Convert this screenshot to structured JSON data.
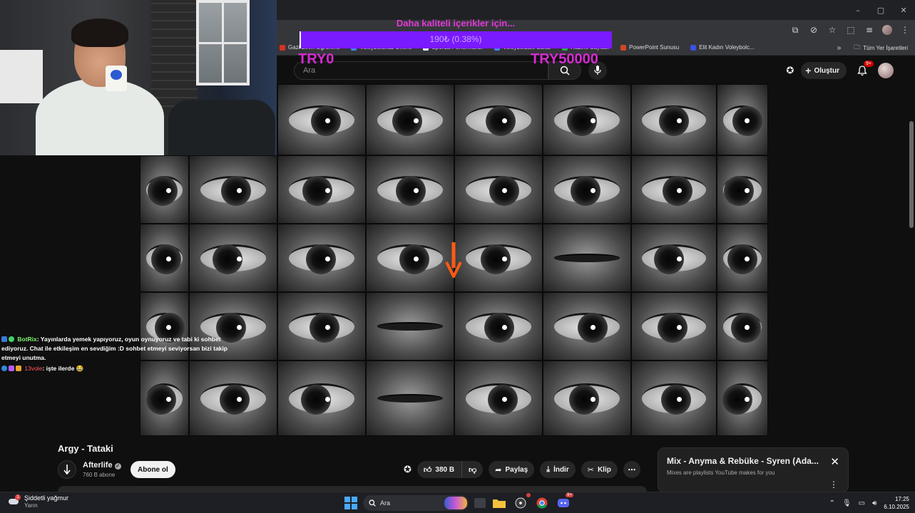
{
  "browser": {
    "window_controls": [
      "–",
      "▢",
      "✕"
    ],
    "bookmarks": [
      {
        "label": "Gazi Birim Öğrenme",
        "color": "#d93025"
      },
      {
        "label": "Voleybolunuz Online",
        "color": "#4285f4"
      },
      {
        "label": "Sporda Performansı",
        "color": "#ffffff"
      },
      {
        "label": "Voleyboldaki Sakal",
        "color": "#4285f4"
      },
      {
        "label": "Hazine Sayfası",
        "color": "#34a853"
      },
      {
        "label": "PowerPoint Sunusu",
        "color": "#d24726"
      },
      {
        "label": "Elit Kadın Voleybolc...",
        "color": "#3c4fe0"
      }
    ],
    "bookmarks_more": "»",
    "all_bookmarks": "Tüm Yer İşaretleri"
  },
  "youtube": {
    "search_placeholder": "Ara",
    "create_label": "Oluştur",
    "notif_badge": "9+"
  },
  "donation": {
    "title": "Daha kaliteli içerikler için...",
    "progress_text": "190₺ (0.38%)",
    "progress_fraction": 0.0038,
    "min_label": "TRY0",
    "max_label": "TRY50000",
    "bar_color": "#7a1aff",
    "text_color": "#d62ad2"
  },
  "chat": [
    {
      "user": "BotRix",
      "text": ": Yayınlarda yemek yapıyoruz, oyun oynuyoruz ve tabi ki sohbet ediyoruz. Chat ile etkileşim en sevdiğim :D sohbet etmeyi seviyorsan bizi takip etmeyi unutma."
    },
    {
      "user": "13vole",
      "text": ": işte ilerde 😂"
    }
  ],
  "video": {
    "title": "Argy - Tataki",
    "channel": "Afterlife",
    "subscribers": "760 B abone",
    "subscribe_label": "Abone ol",
    "likes": "380 B",
    "share_label": "Paylaş",
    "download_label": "İndir",
    "clip_label": "Klip"
  },
  "mix": {
    "title": "Mix - Anyma & Rebüke - Syren (Ada...",
    "subtitle": "Mixes are playlists YouTube makes for you"
  },
  "taskbar": {
    "weather_title": "Şiddetli yağmur",
    "weather_sub": "Yarın",
    "weather_badge": "1",
    "search_placeholder": "Ara",
    "discord_badge": "9+",
    "time": "17:25",
    "date": "6.10.2025"
  }
}
